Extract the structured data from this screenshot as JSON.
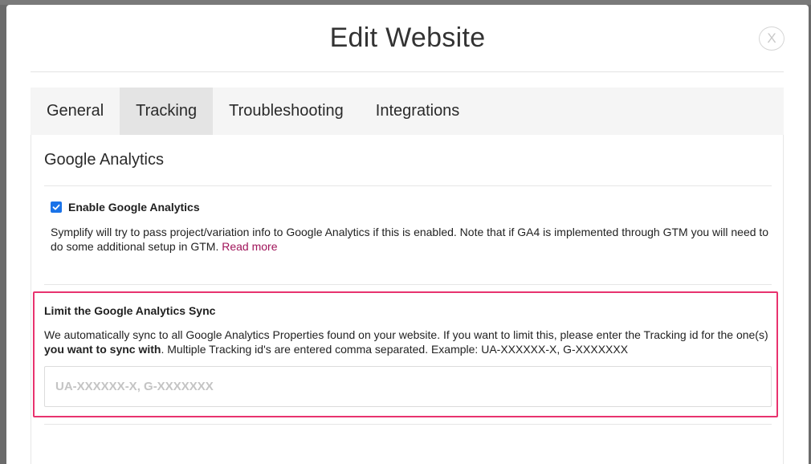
{
  "modal": {
    "title": "Edit Website",
    "close_label": "X"
  },
  "tabs": [
    {
      "label": "General",
      "active": false
    },
    {
      "label": "Tracking",
      "active": true
    },
    {
      "label": "Troubleshooting",
      "active": false
    },
    {
      "label": "Integrations",
      "active": false
    }
  ],
  "google_analytics": {
    "section_title": "Google Analytics",
    "enable_label": "Enable Google Analytics",
    "enabled": true,
    "description": "Symplify will try to pass project/variation info to Google Analytics if this is enabled. Note that if GA4 is implemented through GTM you will need to do some additional setup in GTM.",
    "read_more_label": "Read more"
  },
  "limit_sync": {
    "title": "Limit the Google Analytics Sync",
    "desc_part1": "We automatically sync to all Google Analytics Properties found on your website. If you want to limit this, please enter the Tracking id for the one(s) ",
    "desc_bold": "you want to sync with",
    "desc_part2": ". Multiple Tracking id's are entered comma separated. Example: UA-XXXXXX-X, G-XXXXXXX",
    "input_value": "",
    "input_placeholder": "UA-XXXXXX-X, G-XXXXXXX"
  },
  "colors": {
    "accent_checkbox": "#1a73e8",
    "highlight_border": "#e8336f",
    "link": "#a0145a"
  }
}
